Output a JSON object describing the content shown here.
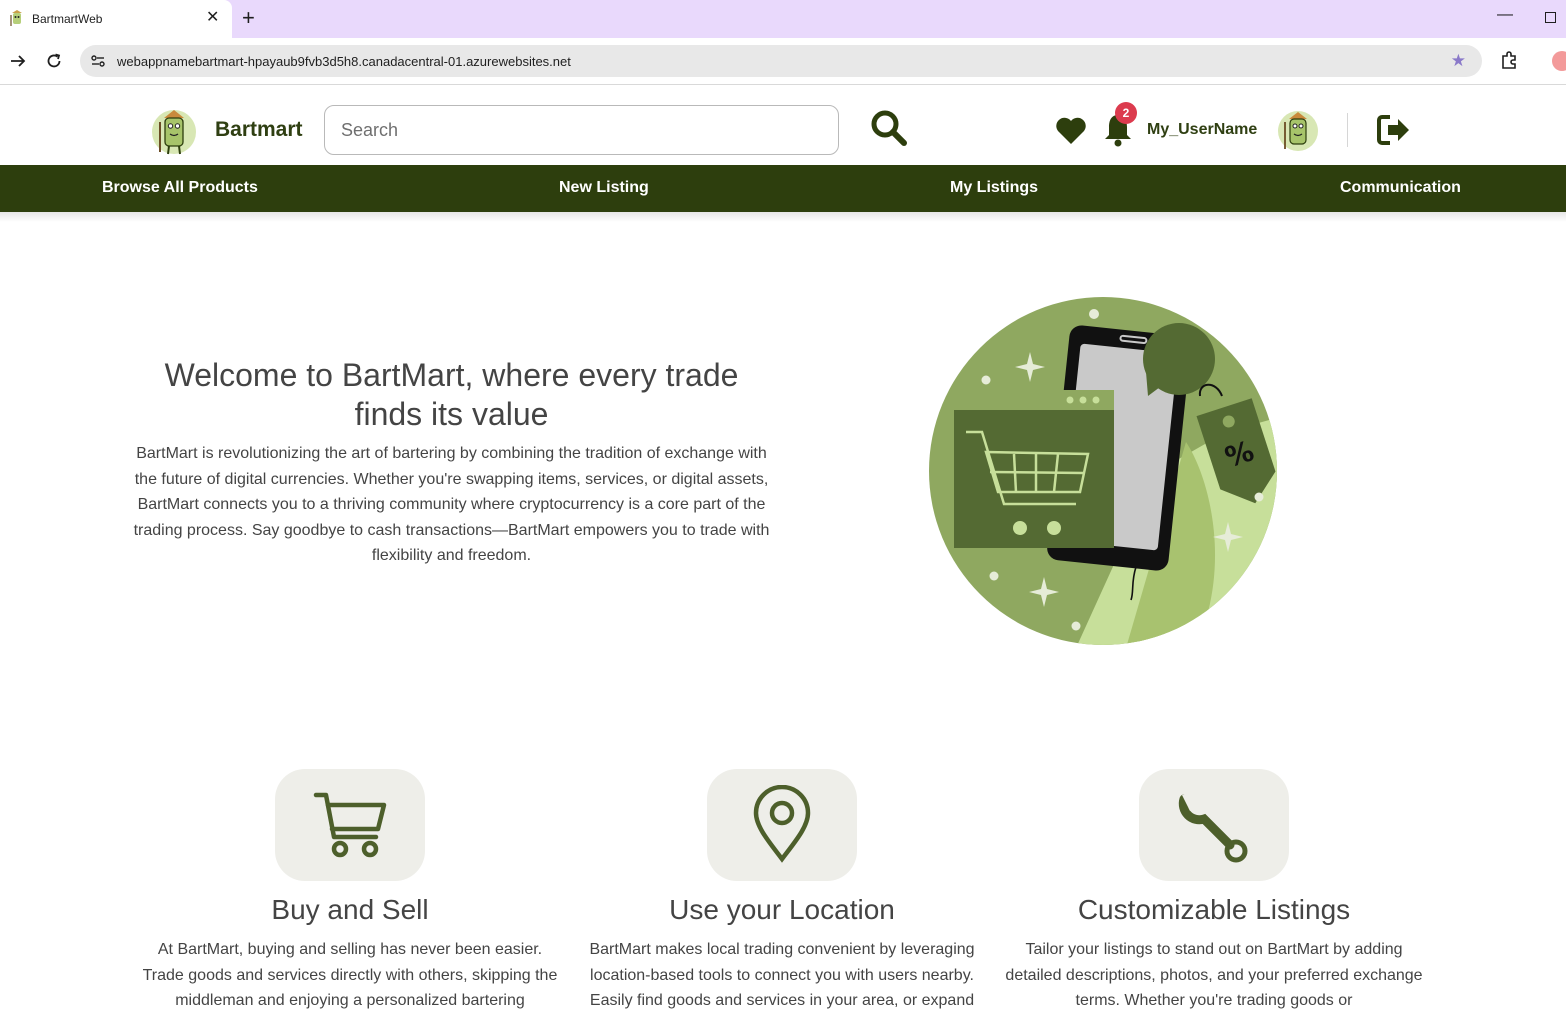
{
  "browser": {
    "tab_title": "BartmartWeb",
    "url": "webappnamebartmart-hpayaub9fvb3d5h8.canadacentral-01.azurewebsites.net"
  },
  "header": {
    "brand": "Bartmart",
    "search_placeholder": "Search",
    "notification_count": "2",
    "username": "My_UserName"
  },
  "nav": {
    "items": [
      "Browse All Products",
      "New Listing",
      "My Listings",
      "Communication"
    ]
  },
  "hero": {
    "title": "Welcome to BartMart, where every trade finds its value",
    "text": "BartMart is revolutionizing the art of bartering by combining the tradition of exchange with the future of digital currencies. Whether you're swapping items, services, or digital assets, BartMart connects you to a thriving community where cryptocurrency is a core part of the trading process. Say goodbye to cash transactions—BartMart empowers you to trade with flexibility and freedom."
  },
  "features": [
    {
      "icon": "cart-icon",
      "title": "Buy and Sell",
      "text": "At BartMart, buying and selling has never been easier. Trade goods and services directly with others, skipping the middleman and enjoying a personalized bartering"
    },
    {
      "icon": "location-pin-icon",
      "title": "Use your Location",
      "text": "BartMart makes local trading convenient by leveraging location-based tools to connect you with users nearby. Easily find goods and services in your area, or expand"
    },
    {
      "icon": "wrench-icon",
      "title": "Customizable Listings",
      "text": "Tailor your listings to stand out on BartMart by adding detailed descriptions, photos, and your preferred exchange terms. Whether you're trading goods or"
    }
  ],
  "colors": {
    "brand_dark": "#2d3e0d",
    "accent_green": "#8fa860",
    "badge_red": "#dc3b4e",
    "tabbar": "#e9d9fc"
  }
}
